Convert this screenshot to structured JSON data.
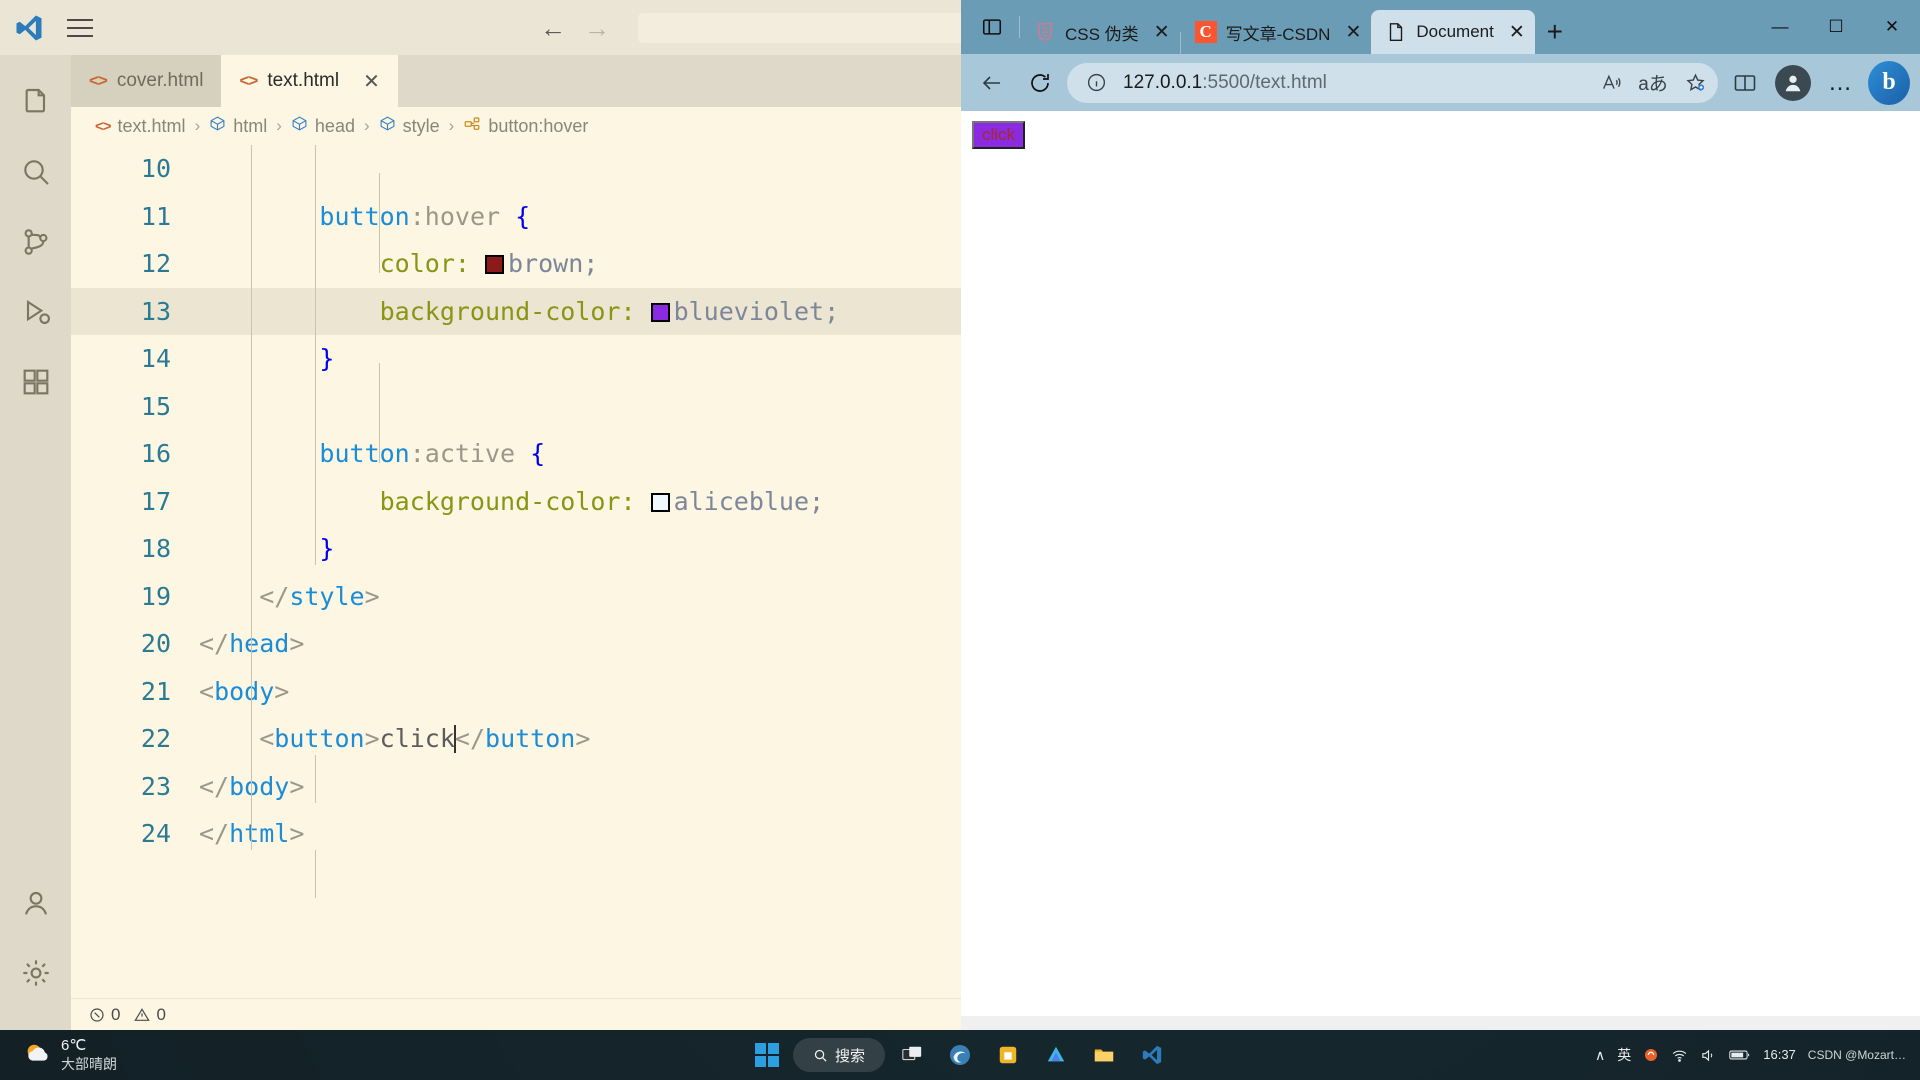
{
  "vscode": {
    "window_title": "VS Code",
    "activity_bar": [
      {
        "name": "explorer",
        "icon": "files-icon"
      },
      {
        "name": "search",
        "icon": "search-icon"
      },
      {
        "name": "source-control",
        "icon": "source-control-icon"
      },
      {
        "name": "run-debug",
        "icon": "run-and-debug-icon"
      },
      {
        "name": "extensions",
        "icon": "extensions-icon"
      },
      {
        "name": "accounts",
        "icon": "account-icon"
      },
      {
        "name": "settings",
        "icon": "gear-icon"
      }
    ],
    "tabs": [
      {
        "label": "cover.html",
        "active": false,
        "closable": false
      },
      {
        "label": "text.html",
        "active": true,
        "closable": true
      }
    ],
    "breadcrumb": [
      "text.html",
      "html",
      "head",
      "style",
      "button:hover"
    ],
    "breadcrumb_separator": "›",
    "status": {
      "errors": "0",
      "warnings": "0"
    },
    "editor": {
      "current_line": 13,
      "lines": [
        {
          "n": "10",
          "segments": []
        },
        {
          "n": "11",
          "segments": [
            {
              "t": "        ",
              "c": "tok-punct"
            },
            {
              "t": "button",
              "c": "tok-sel"
            },
            {
              "t": ":hover ",
              "c": "tok-pseudo"
            },
            {
              "t": "{",
              "c": "tok-brace"
            }
          ]
        },
        {
          "n": "12",
          "segments": [
            {
              "t": "            ",
              "c": "tok-punct"
            },
            {
              "t": "color:",
              "c": "tok-prop"
            },
            {
              "t": " ",
              "c": "tok-val"
            },
            {
              "t": "@swatch:#8b1a1a",
              "c": "swatch"
            },
            {
              "t": "brown;",
              "c": "tok-val"
            }
          ]
        },
        {
          "n": "13",
          "segments": [
            {
              "t": "            ",
              "c": "tok-punct"
            },
            {
              "t": "background-color:",
              "c": "tok-prop"
            },
            {
              "t": " ",
              "c": "tok-val"
            },
            {
              "t": "@swatch:#8a2be2",
              "c": "swatch"
            },
            {
              "t": "blueviolet;",
              "c": "tok-val"
            }
          ]
        },
        {
          "n": "14",
          "segments": [
            {
              "t": "        ",
              "c": "tok-punct"
            },
            {
              "t": "}",
              "c": "tok-brace"
            }
          ]
        },
        {
          "n": "15",
          "segments": []
        },
        {
          "n": "16",
          "segments": [
            {
              "t": "        ",
              "c": "tok-punct"
            },
            {
              "t": "button",
              "c": "tok-sel"
            },
            {
              "t": ":active ",
              "c": "tok-pseudo"
            },
            {
              "t": "{",
              "c": "tok-brace"
            }
          ]
        },
        {
          "n": "17",
          "segments": [
            {
              "t": "            ",
              "c": "tok-punct"
            },
            {
              "t": "background-color:",
              "c": "tok-prop"
            },
            {
              "t": " ",
              "c": "tok-val"
            },
            {
              "t": "@swatch:#f0f8ff",
              "c": "swatch"
            },
            {
              "t": "aliceblue;",
              "c": "tok-val"
            }
          ]
        },
        {
          "n": "18",
          "segments": [
            {
              "t": "        ",
              "c": "tok-punct"
            },
            {
              "t": "}",
              "c": "tok-brace"
            }
          ]
        },
        {
          "n": "19",
          "segments": [
            {
              "t": "    ",
              "c": "tok-punct"
            },
            {
              "t": "</",
              "c": "tok-punct"
            },
            {
              "t": "style",
              "c": "tok-tag"
            },
            {
              "t": ">",
              "c": "tok-punct"
            }
          ]
        },
        {
          "n": "20",
          "segments": [
            {
              "t": "</",
              "c": "tok-punct"
            },
            {
              "t": "head",
              "c": "tok-tag"
            },
            {
              "t": ">",
              "c": "tok-punct"
            }
          ]
        },
        {
          "n": "21",
          "segments": [
            {
              "t": "<",
              "c": "tok-punct"
            },
            {
              "t": "body",
              "c": "tok-tag"
            },
            {
              "t": ">",
              "c": "tok-punct"
            }
          ]
        },
        {
          "n": "22",
          "segments": [
            {
              "t": "    ",
              "c": "tok-punct"
            },
            {
              "t": "<",
              "c": "tok-punct"
            },
            {
              "t": "button",
              "c": "tok-tag"
            },
            {
              "t": ">",
              "c": "tok-punct"
            },
            {
              "t": "click",
              "c": "tok-text"
            },
            {
              "t": "</",
              "c": "tok-punct"
            },
            {
              "t": "button",
              "c": "tok-tag"
            },
            {
              "t": ">",
              "c": "tok-punct"
            }
          ]
        },
        {
          "n": "23",
          "segments": [
            {
              "t": "</",
              "c": "tok-punct"
            },
            {
              "t": "body",
              "c": "tok-tag"
            },
            {
              "t": ">",
              "c": "tok-punct"
            }
          ]
        },
        {
          "n": "24",
          "segments": [
            {
              "t": "</",
              "c": "tok-punct"
            },
            {
              "t": "html",
              "c": "tok-tag"
            },
            {
              "t": ">",
              "c": "tok-punct"
            }
          ]
        }
      ]
    }
  },
  "edge": {
    "tabs": [
      {
        "label": "CSS 伪类",
        "favicon": "css3-icon",
        "active": false
      },
      {
        "label": "写文章-CSDN",
        "favicon": "csdn-icon",
        "active": false
      },
      {
        "label": "Document",
        "favicon": "page-icon",
        "active": true
      }
    ],
    "new_tab_label": "+",
    "window_controls": {
      "minimize": "—",
      "maximize": "☐",
      "close": "✕"
    },
    "toolbar": {
      "back_label": "←",
      "refresh_label": "↻",
      "url_host": "127.0.0.1",
      "url_path": ":5500/text.html",
      "read_aloud_label": "A",
      "translate_label": "aあ",
      "favorite_label": "☆",
      "split_screen_label": "◫",
      "more_label": "…",
      "copilot_label": "b"
    },
    "page": {
      "button_label": "click",
      "button_bg": "#8a2be2",
      "button_color": "#a52a2a"
    }
  },
  "taskbar": {
    "weather": {
      "temperature": "6℃",
      "description": "大部晴朗"
    },
    "search_label": "搜索",
    "apps": [
      "task-view",
      "edge",
      "store",
      "app-orange",
      "file-explorer",
      "vscode"
    ],
    "tray": {
      "chevron": "∧",
      "ime": "英",
      "time": "16:37",
      "watermark": "CSDN @Mozart…"
    }
  }
}
